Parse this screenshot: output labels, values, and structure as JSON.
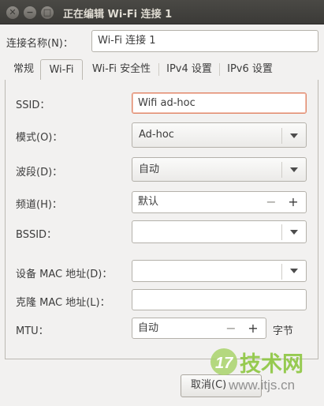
{
  "window": {
    "title": "正在编辑 Wi-Fi 连接 1",
    "close_glyph": "✕",
    "min_glyph": "−",
    "max_glyph": "□"
  },
  "connection_name": {
    "label": "连接名称(N)：",
    "value": "Wi-Fi 连接 1"
  },
  "tabs": [
    {
      "label": "常规",
      "active": false
    },
    {
      "label": "Wi-Fi",
      "active": true
    },
    {
      "label": "Wi-Fi 安全性",
      "active": false
    },
    {
      "label": "IPv4 设置",
      "active": false
    },
    {
      "label": "IPv6 设置",
      "active": false
    }
  ],
  "wifi": {
    "ssid": {
      "label": "SSID：",
      "value": "Wifi ad-hoc"
    },
    "mode": {
      "label": "模式(O)：",
      "value": "Ad-hoc"
    },
    "band": {
      "label": "波段(D)：",
      "value": "自动"
    },
    "channel": {
      "label": "频道(H)：",
      "value": "默认",
      "minus": "−",
      "plus": "+"
    },
    "bssid": {
      "label": "BSSID：",
      "value": ""
    },
    "device_mac": {
      "label": "设备 MAC 地址(D)：",
      "value": ""
    },
    "cloned_mac": {
      "label": "克隆 MAC 地址(L)：",
      "value": ""
    },
    "mtu": {
      "label": "MTU：",
      "value": "自动",
      "minus": "−",
      "plus": "+",
      "unit": "字节"
    }
  },
  "buttons": {
    "cancel": "取消(C)"
  },
  "watermark": {
    "number": "17",
    "brand": "技术网",
    "url": "www.itjs.cn"
  },
  "colors": {
    "titlebar": "#3b3a37",
    "focus_border": "#e0876a",
    "watermark_green": "#8dc63f"
  }
}
